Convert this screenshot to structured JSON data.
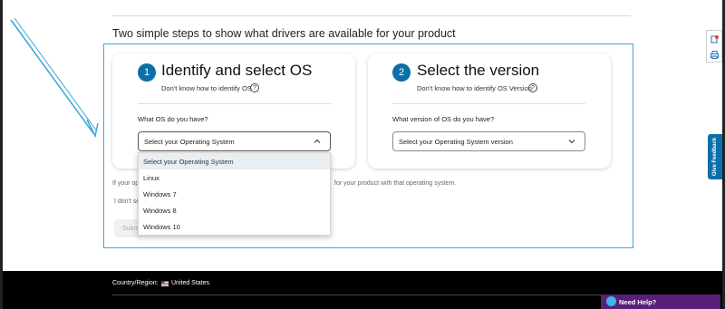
{
  "headline": "Two simple steps to show what drivers are available for your product",
  "step1": {
    "number": "1",
    "title": "Identify and select OS",
    "help_text": "Don't know how to identify OS",
    "field_label": "What OS do you have?",
    "select_value": "Select your Operating System",
    "options": [
      "Select your Operating System",
      "Linux",
      "Windows 7",
      "Windows 8",
      "Windows 10"
    ],
    "selected_option": "Select your Operating System"
  },
  "step2": {
    "number": "2",
    "title": "Select the version",
    "help_text": "Don't know how to identify OS Version",
    "field_label": "What version of OS do you have?",
    "select_value": "Select your Operating System version"
  },
  "body": {
    "partial_left": "If your op",
    "partial_right": "for your product with that operating system.",
    "partial_second": "I don't se"
  },
  "submit_label": "Submit",
  "footer": {
    "country_label": "Country/Region:",
    "country_value": "United States"
  },
  "need_help_label": "Need Help?",
  "feedback_label": "Give Feedback",
  "colors": {
    "accent_blue": "#0b6fa8",
    "outline_blue": "#3aa7d9",
    "annotation_arrow": "#3aa7d9",
    "need_help_purple": "#5a1f78",
    "footer_black": "#000000"
  },
  "icons": [
    "help-circle-icon",
    "chevron-up-icon",
    "chevron-down-icon",
    "us-flag-icon",
    "chat-bubble-icon",
    "notification-icon",
    "print-icon"
  ]
}
